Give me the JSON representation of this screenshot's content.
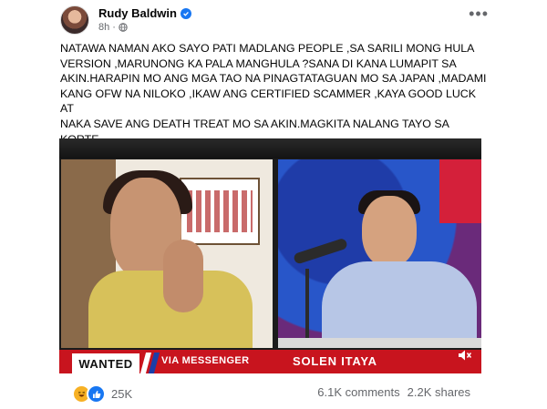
{
  "post": {
    "author": "Rudy Baldwin",
    "time": "8h",
    "privacy_icon": "globe-icon",
    "more_icon": "more-options-icon",
    "text": "NATAWA NAMAN AKO SAYO PATI MADLANG PEOPLE ,SA SARILI MONG HULA\nVERSION ,MARUNONG KA PALA MANGHULA ?SANA DI KANA LUMAPIT SA\nAKIN.HARAPIN MO ANG MGA TAO NA PINAGTATAGUAN MO SA JAPAN ,MADAMI\nKANG OFW NA NILOKO ,IKAW ANG CERTIFIED SCAMMER ,KAYA GOOD LUCK AT\nNAKA SAVE ANG DEATH TREAT MO SA AKIN.MAGKITA NALANG TAYO SA KORTE\nMS SOLEN."
  },
  "video": {
    "lower_third": {
      "wanted": "WANTED",
      "via": "VIA MESSENGER",
      "name": "SOLEN ITAYA"
    },
    "mute_icon": "volume-muted-icon"
  },
  "engagement": {
    "reaction_count": "25K",
    "comments": "6.1K comments",
    "shares": "2.2K shares"
  },
  "colors": {
    "accent": "#1877f2",
    "lower_third_red": "#c8141e",
    "meta_gray": "#65676b"
  }
}
